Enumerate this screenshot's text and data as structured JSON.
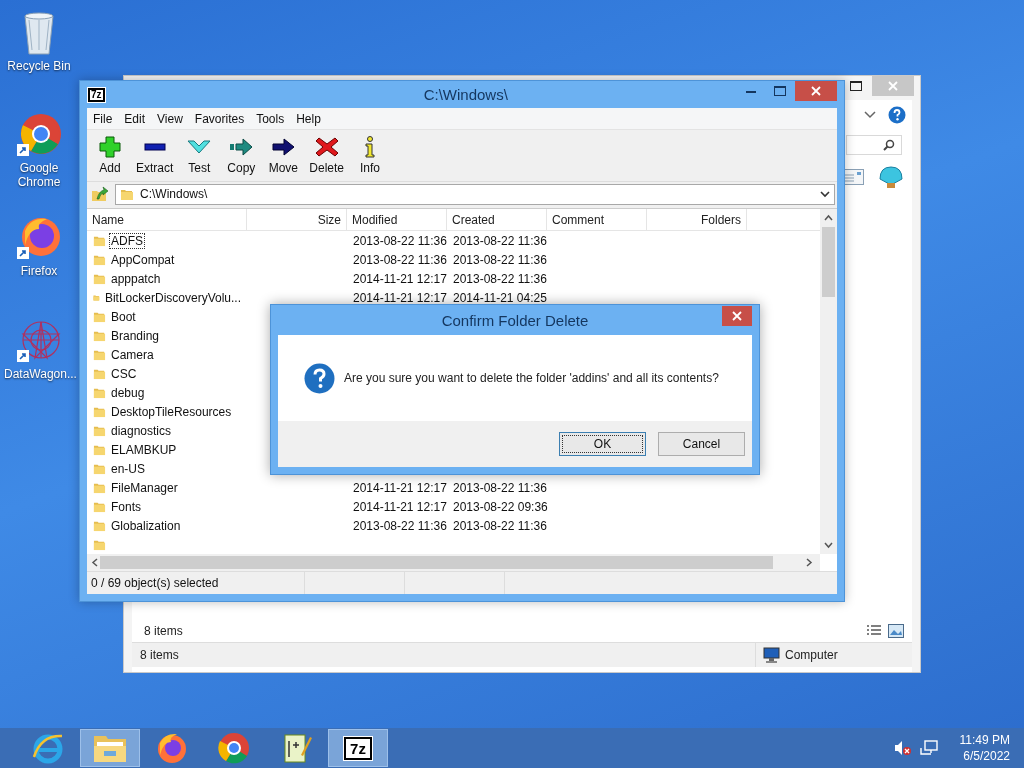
{
  "desktop_icons": [
    {
      "label": "Recycle Bin",
      "kind": "recycle"
    },
    {
      "label": "Google Chrome",
      "kind": "chrome"
    },
    {
      "label": "Firefox",
      "kind": "firefox"
    },
    {
      "label": "DataWagon...",
      "kind": "datawagon"
    }
  ],
  "background_window": {
    "footer_count": "8 items",
    "status_count": "8 items",
    "location": "Computer"
  },
  "archive_window": {
    "logo": "7z",
    "title": "C:\\Windows\\",
    "menu": [
      "File",
      "Edit",
      "View",
      "Favorites",
      "Tools",
      "Help"
    ],
    "toolbar": [
      {
        "label": "Add",
        "kind": "add"
      },
      {
        "label": "Extract",
        "kind": "extract"
      },
      {
        "label": "Test",
        "kind": "test"
      },
      {
        "label": "Copy",
        "kind": "copy"
      },
      {
        "label": "Move",
        "kind": "move"
      },
      {
        "label": "Delete",
        "kind": "delete"
      },
      {
        "label": "Info",
        "kind": "info"
      }
    ],
    "address": "C:\\Windows\\",
    "columns": [
      "Name",
      "Size",
      "Modified",
      "Created",
      "Comment",
      "Folders"
    ],
    "rows": [
      {
        "kind": "folder",
        "name": "ADFS",
        "modified": "2013-08-22 11:36",
        "created": "2013-08-22 11:36",
        "focused": true
      },
      {
        "kind": "folder",
        "name": "AppCompat",
        "modified": "2013-08-22 11:36",
        "created": "2013-08-22 11:36",
        "focused": false
      },
      {
        "kind": "folder",
        "name": "apppatch",
        "modified": "2014-11-21 12:17",
        "created": "2013-08-22 11:36",
        "focused": false
      },
      {
        "kind": "folder",
        "name": "BitLockerDiscoveryVolu...",
        "modified": "2014-11-21 12:17",
        "created": "2014-11-21 04:25",
        "focused": false
      },
      {
        "kind": "folder",
        "name": "Boot",
        "focused": false
      },
      {
        "kind": "folder",
        "name": "Branding",
        "focused": false
      },
      {
        "kind": "folder",
        "name": "Camera",
        "focused": false
      },
      {
        "kind": "folder",
        "name": "CSC",
        "focused": false
      },
      {
        "kind": "folder",
        "name": "debug",
        "focused": false
      },
      {
        "kind": "folder",
        "name": "DesktopTileResources",
        "focused": false
      },
      {
        "kind": "folder",
        "name": "diagnostics",
        "focused": false
      },
      {
        "kind": "folder",
        "name": "ELAMBKUP",
        "focused": false
      },
      {
        "kind": "folder",
        "name": "en-US",
        "focused": false
      },
      {
        "kind": "folder",
        "name": "FileManager",
        "modified": "2014-11-21 12:17",
        "created": "2013-08-22 11:36",
        "focused": false
      },
      {
        "kind": "folder",
        "name": "Fonts",
        "modified": "2014-11-21 12:17",
        "created": "2013-08-22 09:36",
        "focused": false
      },
      {
        "kind": "folder",
        "name": "Globalization",
        "modified": "2013-08-22 11:36",
        "created": "2013-08-22 11:36",
        "focused": false
      },
      {
        "kind": "folder"
      }
    ],
    "status": "0 / 69 object(s) selected"
  },
  "dialog": {
    "title": "Confirm Folder Delete",
    "message": "Are you sure you want to delete the folder 'addins' and all its contents?",
    "buttons": [
      {
        "label": "OK",
        "default": true
      },
      {
        "label": "Cancel",
        "default": false
      }
    ]
  },
  "taskbar": {
    "apps": [
      {
        "kind": "ie",
        "running": false
      },
      {
        "kind": "explorer",
        "running": true
      },
      {
        "kind": "firefox",
        "running": false
      },
      {
        "kind": "chrome",
        "running": false
      },
      {
        "kind": "notepad",
        "running": false
      },
      {
        "kind": "archiver",
        "running": true,
        "logo": "7z"
      }
    ],
    "time": "11:49 PM",
    "date": "6/5/2022"
  }
}
